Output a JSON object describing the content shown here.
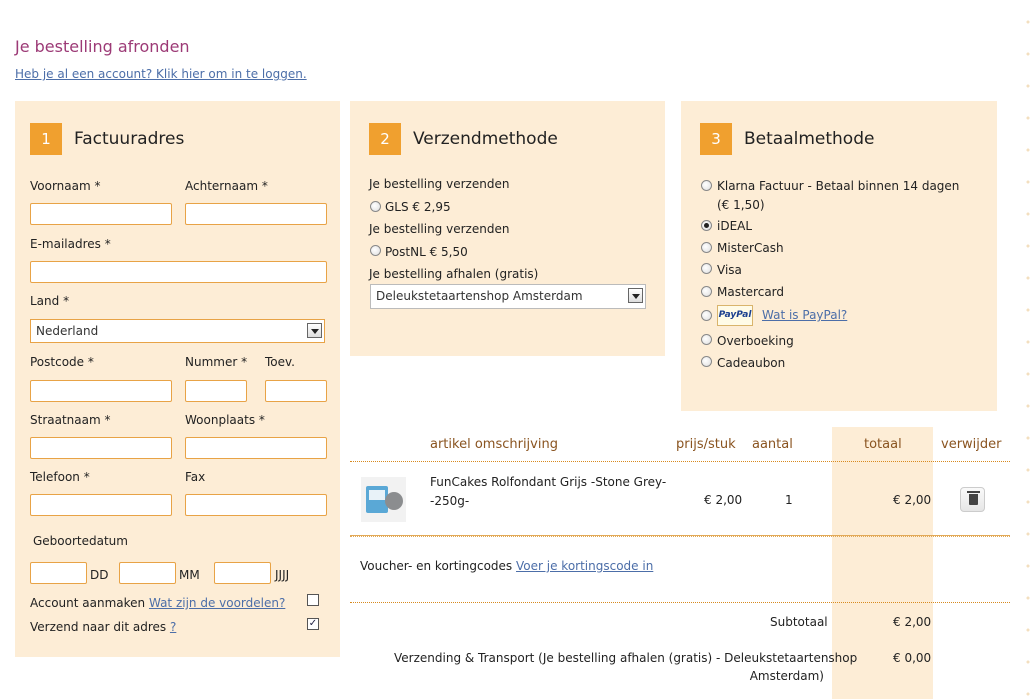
{
  "page": {
    "title": "Je bestelling afronden",
    "login_link": "Heb je al een account? Klik hier om in te loggen."
  },
  "billing": {
    "step": "1",
    "title": "Factuuradres",
    "voornaam": "Voornaam *",
    "achternaam": "Achternaam *",
    "email": "E-mailadres *",
    "land": "Land *",
    "land_value": "Nederland",
    "postcode": "Postcode *",
    "nummer": "Nummer *",
    "toev": "Toev.",
    "straatnaam": "Straatnaam *",
    "woonplaats": "Woonplaats *",
    "telefoon": "Telefoon *",
    "fax": "Fax",
    "geboortedatum": "Geboortedatum",
    "dd": "DD",
    "mm": "MM",
    "jjjj": "JJJJ",
    "account_label": "Account aanmaken",
    "account_link": "Wat zijn de voordelen?",
    "verzend_label": "Verzend naar dit adres",
    "verzend_link": "?",
    "verzend_checked_glyph": "✓"
  },
  "shipping": {
    "step": "2",
    "title": "Verzendmethode",
    "group1": "Je bestelling verzenden",
    "opt1": "GLS € 2,95",
    "group2": "Je bestelling verzenden",
    "opt2": "PostNL € 5,50",
    "group3": "Je bestelling afhalen (gratis)",
    "pickup_value": "Deleukstetaartenshop Amsterdam"
  },
  "payment": {
    "step": "3",
    "title": "Betaalmethode",
    "klarna_line1": "Klarna Factuur - Betaal binnen 14 dagen",
    "klarna_line2": "(€ 1,50)",
    "ideal": "iDEAL",
    "mistercash": "MisterCash",
    "visa": "Visa",
    "mastercard": "Mastercard",
    "paypal_logo": "PayPal",
    "paypal_link": "Wat is PayPal?",
    "overboeking": "Overboeking",
    "cadeaubon": "Cadeaubon"
  },
  "cart": {
    "headers": {
      "artikel": "artikel omschrijving",
      "prijs": "prijs/stuk",
      "aantal": "aantal",
      "totaal": "totaal",
      "verwijder": "verwijder"
    },
    "item": {
      "name_line1": "FunCakes Rolfondant Grijs -Stone Grey-",
      "name_line2": "-250g-",
      "price": "€ 2,00",
      "qty": "1",
      "total": "€ 2,00"
    },
    "voucher_label": "Voucher- en kortingcodes",
    "voucher_link": "Voer je kortingscode in",
    "subtotal_label": "Subtotaal",
    "subtotal_value": "€ 2,00",
    "shipping_line1": "Verzending & Transport (Je bestelling afhalen (gratis) - Deleukstetaartenshop",
    "shipping_line2": "Amsterdam)",
    "shipping_value": "€ 0,00"
  },
  "colors": {
    "accent": "#f0a02f",
    "panel": "#fdedd6",
    "title": "#9c3a76",
    "link": "#4c6ea8"
  }
}
